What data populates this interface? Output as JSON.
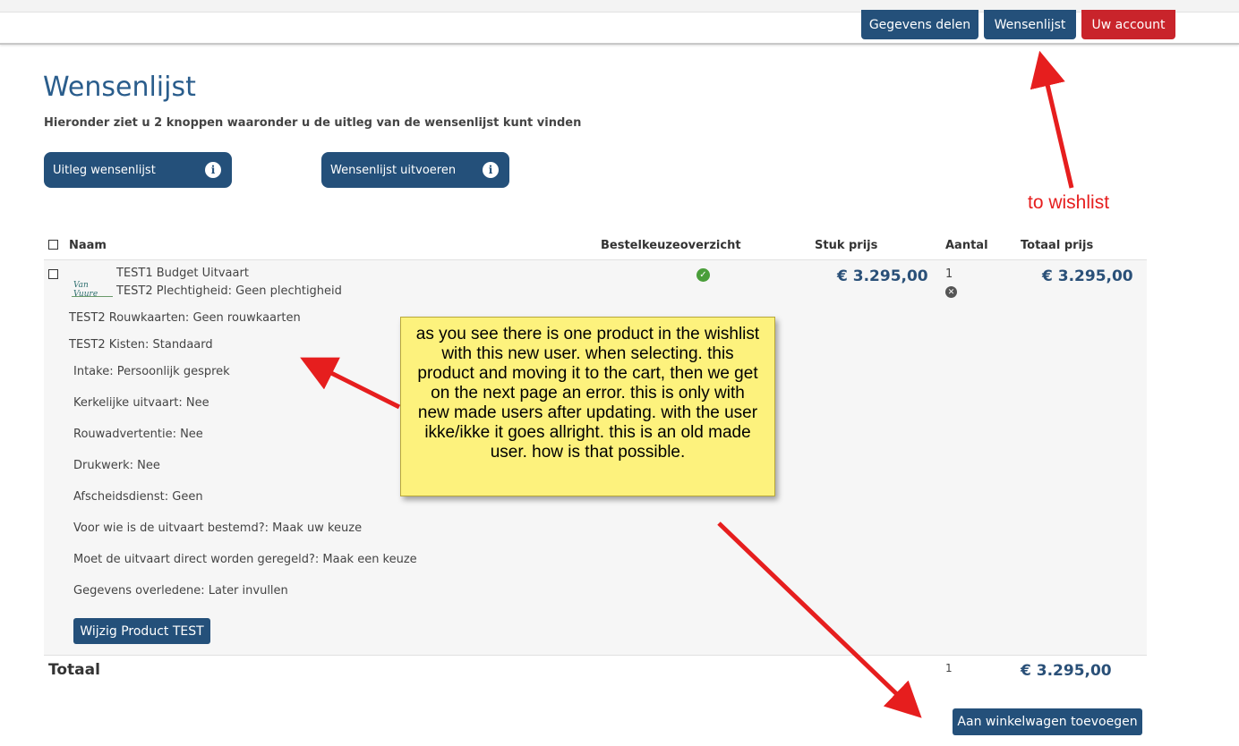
{
  "header": {
    "buttons": [
      {
        "label": "Gegevens delen"
      },
      {
        "label": "Wensenlijst"
      },
      {
        "label": "Uw account"
      }
    ]
  },
  "page": {
    "title": "Wensenlijst",
    "subtitle": "Hieronder ziet u 2 knoppen waaronder u de uitleg van de wensenlijst kunt vinden"
  },
  "info_buttons": [
    {
      "label": "Uitleg wensenlijst",
      "icon": "info-icon"
    },
    {
      "label": "Wensenlijst uitvoeren",
      "icon": "info-icon"
    }
  ],
  "table": {
    "columns": [
      "Naam",
      "Bestelkeuzeoverzicht",
      "Stuk prijs",
      "Aantal",
      "Totaal prijs"
    ],
    "row": {
      "logo_text": "Van Vuure",
      "title": "TEST1 Budget Uitvaart",
      "lines": [
        "TEST2 Plechtigheid: Geen plechtigheid",
        "TEST2 Rouwkaarten: Geen rouwkaarten",
        "TEST2 Kisten: Standaard"
      ],
      "options": [
        "Intake: Persoonlijk gesprek",
        "Kerkelijke uitvaart: Nee",
        "Rouwadvertentie: Nee",
        "Drukwerk: Nee",
        "Afscheidsdienst: Geen",
        "Voor wie is de uitvaart bestemd?: Maak uw keuze",
        "Moet de uitvaart direct worden geregeld?: Maak een keuze",
        "Gegevens overledene: Later invullen"
      ],
      "unit_price": "€ 3.295,00",
      "quantity": "1",
      "total_price": "€ 3.295,00",
      "edit_button": "Wijzig Product TEST"
    },
    "total": {
      "label": "Totaal",
      "quantity": "1",
      "price": "€ 3.295,00"
    }
  },
  "add_to_cart_button": "Aan winkelwagen toevoegen",
  "annotations": {
    "note": "as you see there is one product in the wishlist with this new user. when selecting. this product and moving it to the cart, then we get on the next page an error. this is only with new made users after updating. with the user ikke/ikke it goes allright. this is an old made user. how is that possible.",
    "label": "to wishlist",
    "arrow_color": "#e61e1e",
    "note_color": "#fdf27d"
  },
  "colors": {
    "primary": "#24507a",
    "danger": "#c9242b",
    "title": "#2a5d8c",
    "success": "#4a9e3a"
  }
}
